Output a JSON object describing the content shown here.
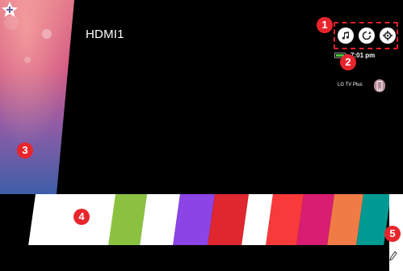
{
  "screen": {
    "input_title": "HDMI1",
    "status": {
      "time": "7:01 pm",
      "battery_level": 1.0,
      "battery_color": "#49c33f"
    },
    "remote": {
      "label": "LG TV Plus",
      "icon": "phone-remote-icon"
    },
    "quick_buttons": [
      {
        "icon": "music-note-icon"
      },
      {
        "icon": "cycle-icon"
      },
      {
        "icon": "settings-gear-icon"
      }
    ],
    "home_icon": "star-plus-icon",
    "edit_icon": "pencil-edit-icon",
    "callouts": [
      "1",
      "2",
      "3",
      "4",
      "5"
    ],
    "colors": {
      "accent": "#e8252c",
      "tiles": [
        "#8ac23f",
        "#ffffff",
        "#8b44e6",
        "#e0262e",
        "#ffffff",
        "#f83a3a",
        "#d81d72",
        "#f07b45",
        "#009a93",
        "#ffffff"
      ]
    }
  }
}
